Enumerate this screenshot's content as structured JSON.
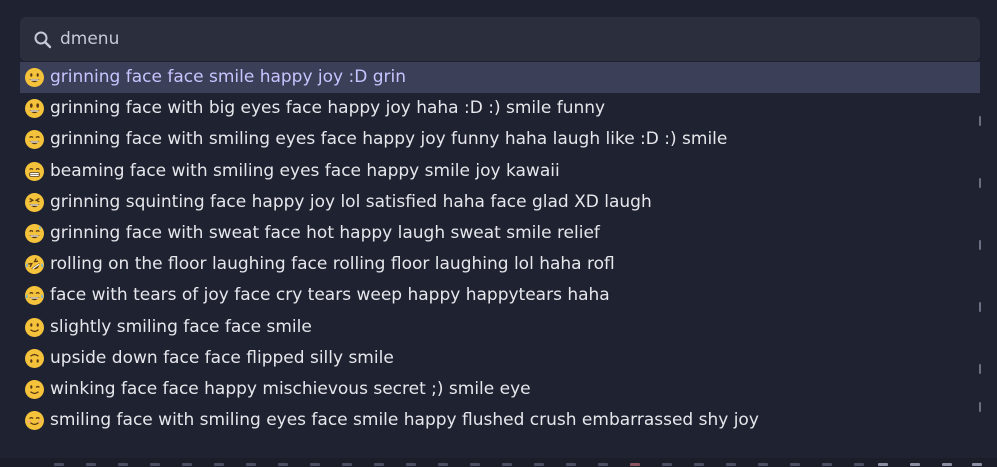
{
  "search": {
    "query": "dmenu",
    "icon": "search-icon"
  },
  "results": [
    {
      "emoji": "grinning-face",
      "label": "grinning face face smile happy joy :D grin",
      "selected": true
    },
    {
      "emoji": "grinning-face-big-eyes",
      "label": "grinning face with big eyes face happy joy haha :D :) smile funny"
    },
    {
      "emoji": "grinning-face-smiling-eyes",
      "label": "grinning face with smiling eyes face happy joy funny haha laugh like :D :) smile"
    },
    {
      "emoji": "beaming-face",
      "label": "beaming face with smiling eyes face happy smile joy kawaii"
    },
    {
      "emoji": "grinning-squinting-face",
      "label": "grinning squinting face happy joy lol satisfied haha face glad XD laugh"
    },
    {
      "emoji": "grinning-face-sweat",
      "label": "grinning face with sweat face hot happy laugh sweat smile relief"
    },
    {
      "emoji": "rolling-on-floor-laughing",
      "label": "rolling on the floor laughing face rolling floor laughing lol haha rofl"
    },
    {
      "emoji": "face-tears-of-joy",
      "label": "face with tears of joy face cry tears weep happy happytears haha"
    },
    {
      "emoji": "slightly-smiling-face",
      "label": "slightly smiling face face smile"
    },
    {
      "emoji": "upside-down-face",
      "label": "upside down face face flipped silly smile"
    },
    {
      "emoji": "winking-face",
      "label": "winking face face happy mischievous secret ;) smile eye"
    },
    {
      "emoji": "smiling-face-smiling-eyes",
      "label": "smiling face with smiling eyes face smile happy flushed crush embarrassed shy joy"
    }
  ],
  "colors": {
    "background": "#1f2230",
    "search_bg": "#2b2e3c",
    "selected_bg": "#3b3f58",
    "selected_text": "#c9c4ff",
    "text": "#e6e7ec",
    "emoji_yellow": "#f5c33b"
  }
}
